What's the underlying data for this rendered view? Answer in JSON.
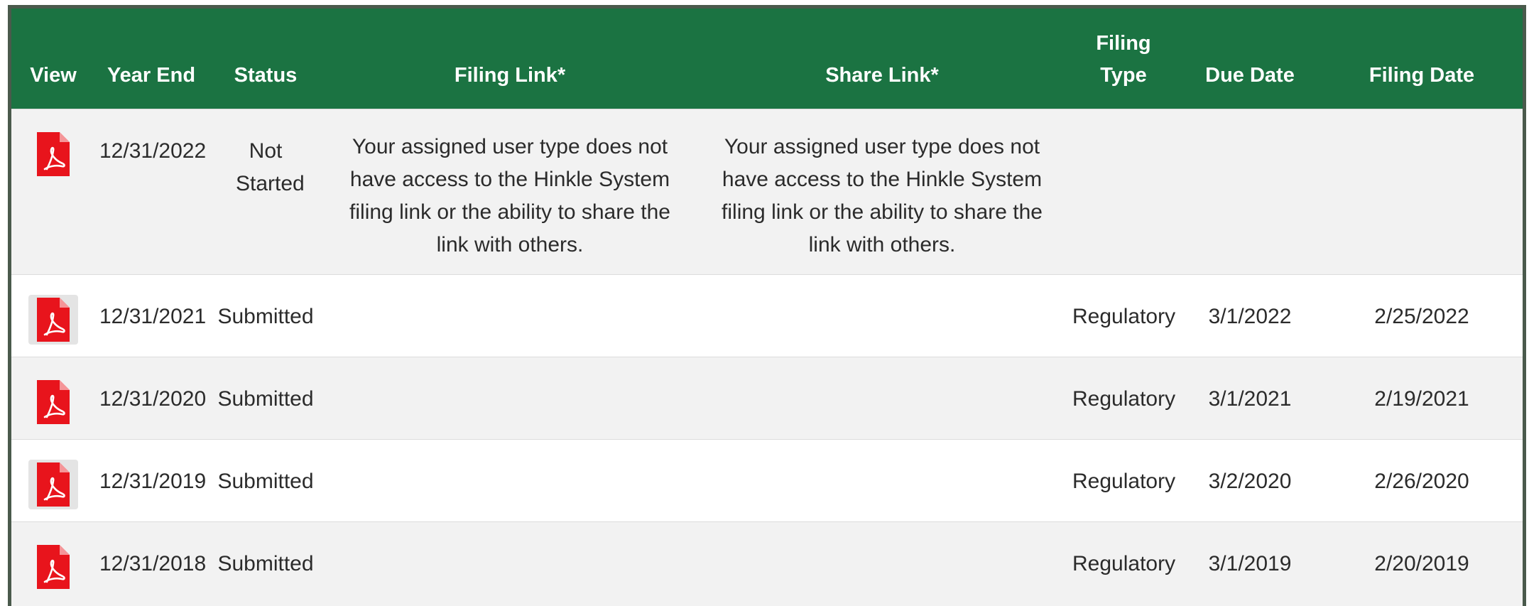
{
  "table": {
    "headers": {
      "view": "View",
      "year_end": "Year End",
      "status": "Status",
      "filing_link": "Filing Link*",
      "share_link": "Share Link*",
      "filing_type": "Filing Type",
      "due_date": "Due Date",
      "filing_date": "Filing Date"
    },
    "rows": [
      {
        "year_end": "12/31/2022",
        "status": "Not Started",
        "filing_link": "Your assigned user type does not have access to the Hinkle System filing link or the ability to share the link with others.",
        "share_link": "Your assigned user type does not have access to the Hinkle System filing link or the ability to share the link with others.",
        "filing_type": "",
        "due_date": "",
        "filing_date": ""
      },
      {
        "year_end": "12/31/2021",
        "status": "Submitted",
        "filing_link": "",
        "share_link": "",
        "filing_type": "Regulatory",
        "due_date": "3/1/2022",
        "filing_date": "2/25/2022"
      },
      {
        "year_end": "12/31/2020",
        "status": "Submitted",
        "filing_link": "",
        "share_link": "",
        "filing_type": "Regulatory",
        "due_date": "3/1/2021",
        "filing_date": "2/19/2021"
      },
      {
        "year_end": "12/31/2019",
        "status": "Submitted",
        "filing_link": "",
        "share_link": "",
        "filing_type": "Regulatory",
        "due_date": "3/2/2020",
        "filing_date": "2/26/2020"
      },
      {
        "year_end": "12/31/2018",
        "status": "Submitted",
        "filing_link": "",
        "share_link": "",
        "filing_type": "Regulatory",
        "due_date": "3/1/2019",
        "filing_date": "2/20/2019"
      }
    ],
    "view_icon": "pdf-file-icon"
  },
  "colors": {
    "header_bg": "#1b7342",
    "header_text": "#ffffff",
    "pdf_icon": "#e8141c",
    "row_alt": "#f2f2f2",
    "frame_border": "#4a5a4c"
  }
}
